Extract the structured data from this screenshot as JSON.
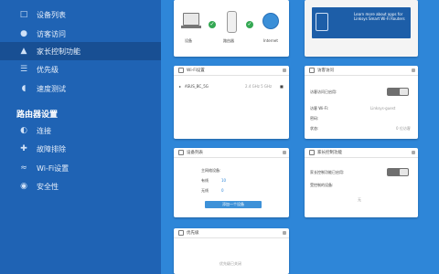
{
  "sidebar": {
    "items_top": [
      {
        "label": "设备列表",
        "icon": "device-list-icon"
      },
      {
        "label": "访客访问",
        "icon": "guest-access-icon"
      },
      {
        "label": "家长控制功能",
        "icon": "parental-control-icon"
      },
      {
        "label": "优先级",
        "icon": "priority-icon"
      },
      {
        "label": "速度测试",
        "icon": "speed-test-icon"
      }
    ],
    "section_title": "路由器设置",
    "items_bottom": [
      {
        "label": "连接",
        "icon": "connectivity-icon"
      },
      {
        "label": "故障排除",
        "icon": "troubleshooting-icon"
      },
      {
        "label": "Wi-Fi设置",
        "icon": "wifi-settings-icon"
      },
      {
        "label": "安全性",
        "icon": "security-icon"
      }
    ]
  },
  "network_map": {
    "labels": [
      "设备",
      "路由器",
      "Internet"
    ]
  },
  "promo": {
    "text": "Learn more about apps for Linksys Smart Wi-Fi Routers"
  },
  "wifi_card": {
    "title": "Wi-Fi设置",
    "network_name": "ASUS_BC_5G",
    "band": "2.4 GHz 5 GHz"
  },
  "guest_card": {
    "title": "访客访问",
    "row1": "访客访问已启用:",
    "row2": "访客 Wi-Fi:",
    "row2_value": "Linksys-guest",
    "row3": "密码:",
    "row4": "状态:",
    "row4_value": "0 位访客"
  },
  "devices_card": {
    "title": "设备列表",
    "row1": "主网络设备:",
    "row2_label": "有线",
    "row2_value": "10",
    "row3_label": "无线",
    "row3_value": "0",
    "button": "添加一个设备"
  },
  "parental_card": {
    "title": "家长控制功能",
    "row1": "家长控制功能已启用:",
    "row2": "受控制的设备:",
    "row3": "无"
  },
  "priority_card": {
    "title": "优先级",
    "text": "优先级已关闭"
  }
}
